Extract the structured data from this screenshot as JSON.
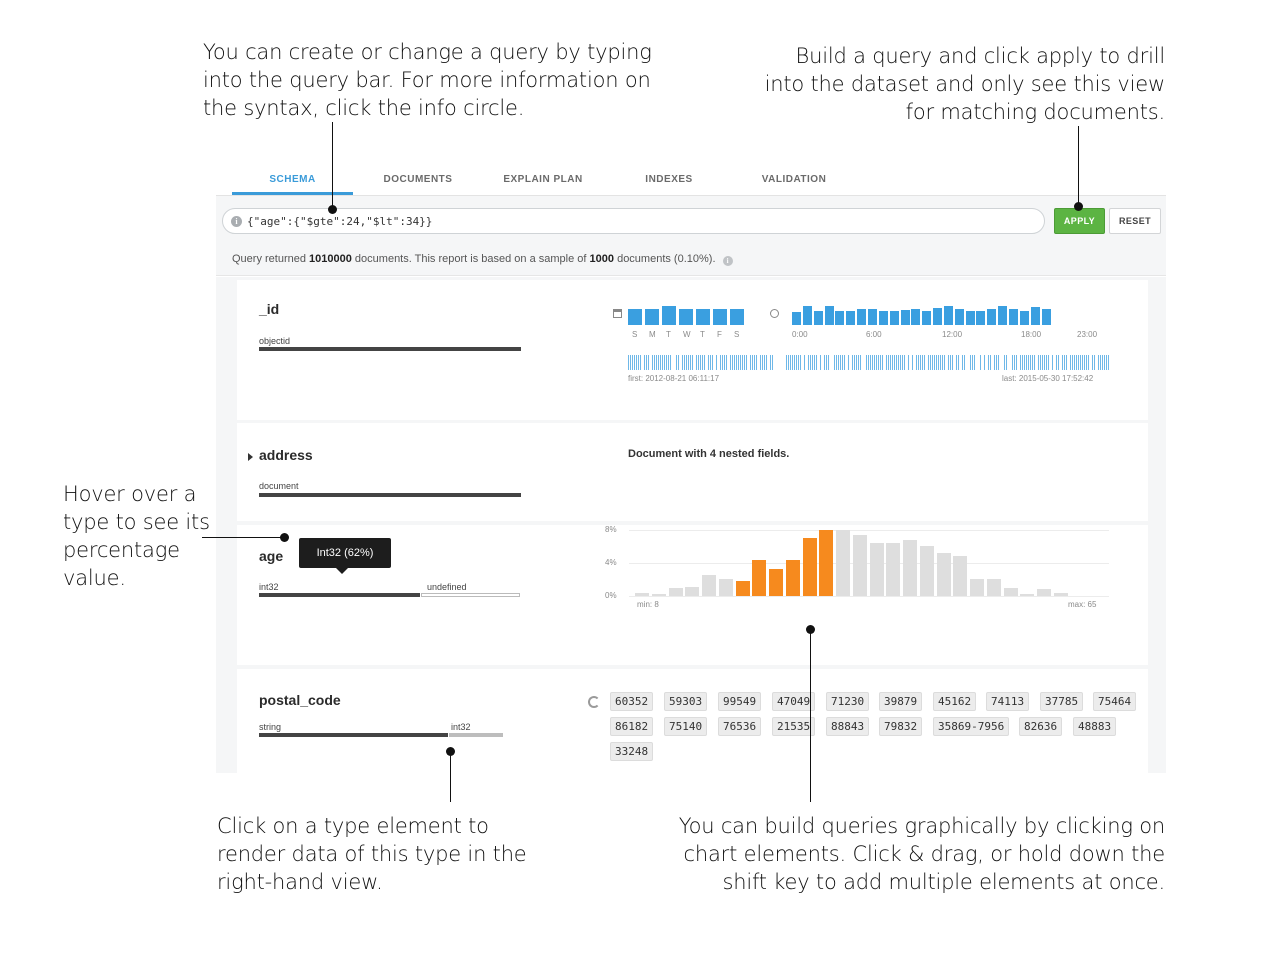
{
  "callouts": {
    "query_bar": [
      "You can create or change a query by typing",
      "into the query bar. For more information on",
      "the syntax, click the info circle."
    ],
    "apply": [
      "Build a query and click apply to drill",
      "into the dataset and only see this view",
      "for matching documents."
    ],
    "hover": [
      "Hover over a",
      "type to see its",
      "percentage",
      "value."
    ],
    "type_click": [
      "Click on a type element to",
      "render data of this type in the",
      "right-hand view."
    ],
    "chart_build": [
      "You can build queries graphically by clicking on",
      "chart elements. Click & drag, or hold down the",
      "shift key to add multiple elements at once."
    ]
  },
  "tabs": [
    "SCHEMA",
    "DOCUMENTS",
    "EXPLAIN PLAN",
    "INDEXES",
    "VALIDATION"
  ],
  "active_tab": "SCHEMA",
  "query": {
    "text": "{\"age\":{\"$gte\":24,\"$lt\":34}}",
    "apply_label": "APPLY",
    "reset_label": "RESET",
    "status_prefix": "Query returned ",
    "returned_count": "1010000",
    "status_mid": " documents. This report is based on a sample of ",
    "sample_count": "1000",
    "status_suffix": " documents (0.10%)."
  },
  "fields": {
    "id": {
      "name": "_id",
      "type": "objectid",
      "days": [
        "S",
        "M",
        "T",
        "W",
        "T",
        "F",
        "S"
      ],
      "day_values": [
        0.85,
        0.85,
        1.0,
        0.85,
        0.85,
        0.85,
        0.85
      ],
      "hour_labels": [
        "0:00",
        "6:00",
        "12:00",
        "18:00",
        "23:00"
      ],
      "hour_values": [
        0.7,
        1.0,
        0.75,
        1.0,
        0.75,
        0.75,
        0.85,
        0.85,
        0.75,
        0.75,
        0.8,
        0.85,
        0.75,
        0.9,
        1.0,
        0.85,
        0.75,
        0.75,
        0.85,
        1.0,
        0.85,
        0.75,
        0.95,
        0.85
      ],
      "first": "first: 2012-08-21 06:11:17",
      "last": "last: 2015-05-30 17:52:42"
    },
    "address": {
      "name": "address",
      "type": "document",
      "summary": "Document with 4 nested fields."
    },
    "age": {
      "name": "age",
      "types": [
        "int32",
        "undefined"
      ],
      "type_fractions": [
        0.62,
        0.38
      ],
      "tooltip": "Int32 (62%)",
      "y_ticks": [
        "8%",
        "4%",
        "0%"
      ],
      "y_max": 8,
      "x_min_label": "min: 8",
      "x_max_label": "max: 65",
      "bar_values": [
        0.4,
        0.2,
        1.0,
        1.1,
        2.6,
        2.1,
        1.8,
        4.4,
        3.3,
        4.4,
        7.0,
        8.0,
        8.0,
        7.4,
        6.4,
        6.4,
        6.8,
        6.1,
        5.2,
        4.8,
        2.0,
        2.0,
        1.0,
        0.1,
        0.8,
        0.4
      ],
      "highlight_start": 6,
      "highlight_end": 11
    },
    "postal_code": {
      "name": "postal_code",
      "types": [
        "string",
        "int32"
      ],
      "type_fractions": [
        0.78,
        0.22
      ],
      "values": [
        "60352",
        "59303",
        "99549",
        "47049",
        "71230",
        "39879",
        "45162",
        "74113",
        "37785",
        "75464",
        "86182",
        "75140",
        "76536",
        "21535",
        "88843",
        "79832",
        "35869-7956",
        "82636",
        "48883",
        "33248"
      ]
    }
  },
  "colors": {
    "accent_blue": "#3a9bd9",
    "apply_green": "#5cb443",
    "highlight_orange": "#f68a1e"
  }
}
